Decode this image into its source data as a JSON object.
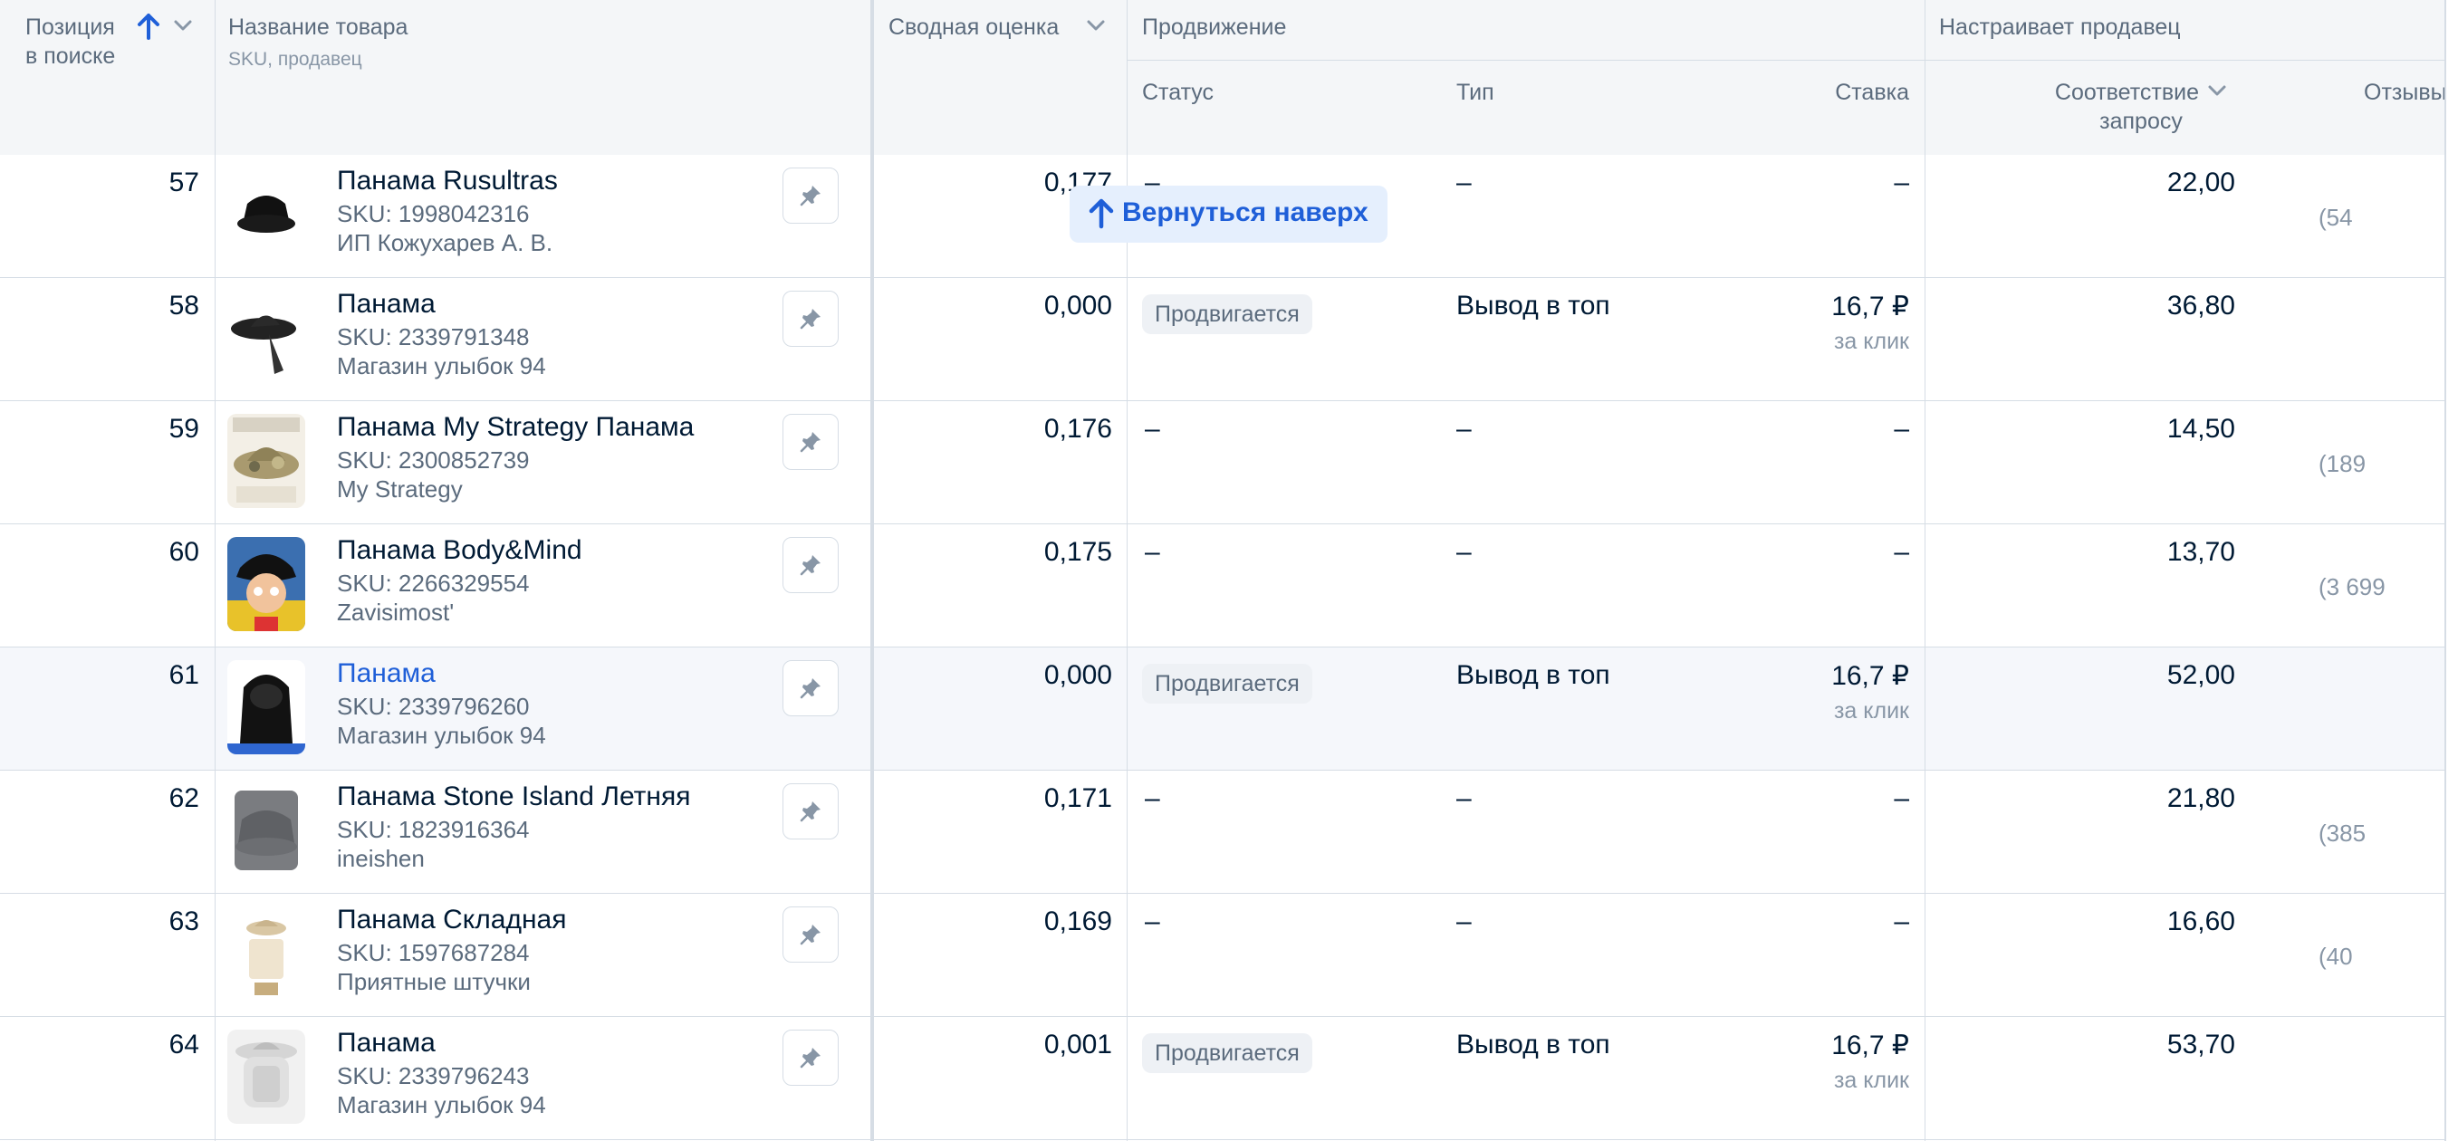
{
  "header": {
    "position_label_line1": "Позиция",
    "position_label_line2": "в поиске",
    "name_label": "Название товара",
    "name_sub": "SKU, продавец",
    "score_label": "Сводная оценка",
    "promo_group": "Продвижение",
    "seller_group": "Настраивает продавец",
    "status_label": "Статус",
    "type_label": "Тип",
    "bid_label": "Ставка",
    "match_label_line1": "Соответствие",
    "match_label_line2": "запросу",
    "reviews_label": "Отзывы"
  },
  "back_to_top": {
    "label": "Вернуться наверх"
  },
  "rows": [
    {
      "position": "57",
      "name": "Панама Rusultras",
      "sku": "SKU: 1998042316",
      "seller": "ИП Кожухарев А. В.",
      "score": "0,177",
      "status": "–",
      "type": "–",
      "bid": "–",
      "bid_unit": "",
      "match": "22,00",
      "reviews": "(54",
      "thumb": "black-bucket-hat"
    },
    {
      "position": "58",
      "name": "Панама",
      "sku": "SKU: 2339791348",
      "seller": "Магазин улыбок 94",
      "score": "0,000",
      "status": "Продвигается",
      "type": "Вывод в топ",
      "bid": "16,7 ₽",
      "bid_unit": "за клик",
      "match": "36,80",
      "reviews": "",
      "thumb": "black-wide-hat"
    },
    {
      "position": "59",
      "name": "Панама My Strategy Панама",
      "sku": "SKU: 2300852739",
      "seller": "My Strategy",
      "score": "0,176",
      "status": "–",
      "type": "–",
      "bid": "–",
      "bid_unit": "",
      "match": "14,50",
      "reviews": "(189",
      "thumb": "camo-hat"
    },
    {
      "position": "60",
      "name": "Панама Body&Mind",
      "sku": "SKU: 2266329554",
      "seller": "Zavisimost'",
      "score": "0,175",
      "status": "–",
      "type": "–",
      "bid": "–",
      "bid_unit": "",
      "match": "13,70",
      "reviews": "(3 699",
      "thumb": "person-hat"
    },
    {
      "position": "61",
      "name": "Панама",
      "sku": "SKU: 2339796260",
      "seller": "Магазин улыбок 94",
      "score": "0,000",
      "status": "Продвигается",
      "type": "Вывод в топ",
      "bid": "16,7 ₽",
      "bid_unit": "за клик",
      "match": "52,00",
      "reviews": "",
      "thumb": "black-hood"
    },
    {
      "position": "62",
      "name": "Панама Stone Island Летняя",
      "sku": "SKU: 1823916364",
      "seller": "ineishen",
      "score": "0,171",
      "status": "–",
      "type": "–",
      "bid": "–",
      "bid_unit": "",
      "match": "21,80",
      "reviews": "(385",
      "thumb": "grey-bucket-hat"
    },
    {
      "position": "63",
      "name": "Панама Складная",
      "sku": "SKU: 1597687284",
      "seller": "Приятные штучки",
      "score": "0,169",
      "status": "–",
      "type": "–",
      "bid": "–",
      "bid_unit": "",
      "match": "16,60",
      "reviews": "(40",
      "thumb": "beige-hat"
    },
    {
      "position": "64",
      "name": "Панама",
      "sku": "SKU: 2339796243",
      "seller": "Магазин улыбок 94",
      "score": "0,001",
      "status": "Продвигается",
      "type": "Вывод в топ",
      "bid": "16,7 ₽",
      "bid_unit": "за клик",
      "match": "53,70",
      "reviews": "",
      "thumb": "white-face-shield-hat"
    }
  ],
  "highlighted_row": 4,
  "colors": {
    "accent": "#1f5fd8",
    "header_bg": "#f4f6f8",
    "border": "#d6dde5",
    "highlight_bg": "#f5f7fb",
    "badge_bg": "#eef1f5"
  }
}
